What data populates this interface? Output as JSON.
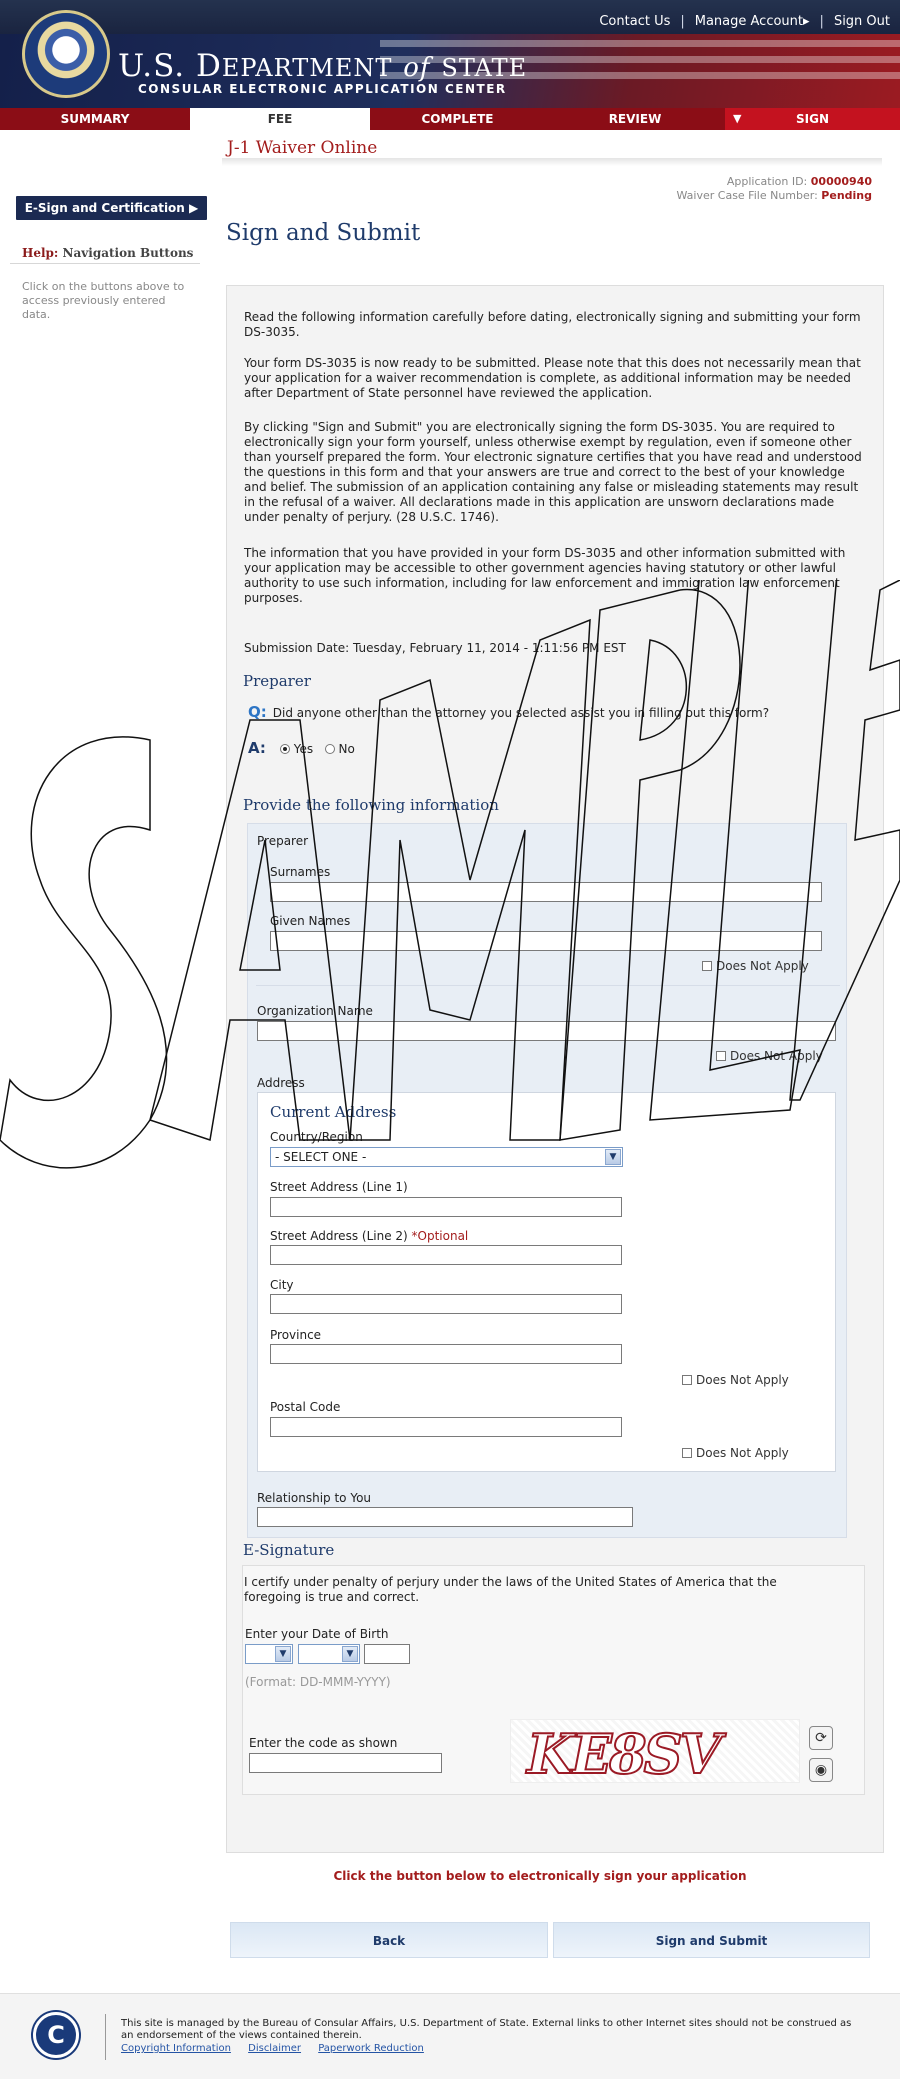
{
  "top_links": {
    "contact": "Contact Us",
    "manage": "Manage Account",
    "signout": "Sign Out"
  },
  "banner": {
    "dept_prefix": "U.S. D",
    "dept_rest": "EPARTMENT",
    "of": "of",
    "state": "STATE",
    "subtitle": "CONSULAR ELECTRONIC APPLICATION CENTER"
  },
  "tabs": {
    "summary": "SUMMARY",
    "fee": "FEE",
    "complete": "COMPLETE",
    "review": "REVIEW",
    "sign": "SIGN"
  },
  "sidebar": {
    "button": "E-Sign and Certification",
    "help_label": "Help:",
    "help_topic": "Navigation Buttons",
    "help_text": "Click on the buttons above to access previously entered data."
  },
  "header": {
    "app_title": "J-1 Waiver Online",
    "app_id_label": "Application ID:",
    "app_id": "00000940",
    "case_label": "Waiver Case File Number:",
    "case_value": "Pending"
  },
  "page_title": "Sign and Submit",
  "intro": {
    "p1": "Read the following information carefully before dating, electronically signing and submitting your form DS-3035.",
    "p2": "Your form DS-3035 is now ready to be submitted. Please note that this does not necessarily mean that your application for a waiver recommendation is complete, as additional information may be needed after Department of State personnel have reviewed the application.",
    "p3": "By clicking \"Sign and Submit\" you are electronically signing the form DS-3035. You are required to electronically sign your form yourself, unless otherwise exempt by regulation, even if someone other than yourself prepared the form. Your electronic signature certifies that you have read and understood the questions in this form and that your answers are true and correct to the best of your knowledge and belief. The submission of an application containing any false or misleading statements may result in the refusal of a waiver. All declarations made in this application are unsworn declarations made under penalty of perjury. (28 U.S.C. 1746).",
    "p4": "The information that you have provided in your form DS-3035 and other information submitted with your application may be accessible to other government agencies having statutory or other lawful authority to use such information, including for law enforcement and immigration law enforcement purposes.",
    "submission": "Submission Date: Tuesday, February 11, 2014 - 1:11:56 PM EST"
  },
  "preparer": {
    "heading": "Preparer",
    "q_mark": "Q:",
    "question": "Did anyone other than the attorney you selected assist you in filling out this form?",
    "a_mark": "A:",
    "yes": "Yes",
    "no": "No"
  },
  "info": {
    "heading": "Provide the following information",
    "box_label": "Preparer",
    "surnames": "Surnames",
    "given": "Given Names",
    "dna": "Does Not Apply",
    "org": "Organization Name",
    "address": "Address",
    "current_address": "Current Address",
    "country": "Country/Region",
    "country_value": "- SELECT ONE -",
    "street1": "Street Address (Line 1)",
    "street2": "Street Address (Line 2)",
    "optional": "*Optional",
    "city": "City",
    "province": "Province",
    "postal": "Postal Code",
    "relationship": "Relationship to You"
  },
  "esig": {
    "heading": "E-Signature",
    "certify": "I certify under penalty of perjury under the laws of the United States of America that the foregoing is true and correct.",
    "dob": "Enter your Date of Birth",
    "format": "(Format: DD-MMM-YYYY)",
    "code": "Enter the code as shown",
    "captcha": "KE8SV"
  },
  "notice": "Click the button below to electronically sign your application",
  "buttons": {
    "back": "Back",
    "submit": "Sign and Submit"
  },
  "footer": {
    "text": "This site is managed by the Bureau of Consular Affairs, U.S. Department of State. External links to other Internet sites should not be construed as an endorsement of the views contained therein.",
    "links": [
      "Copyright Information",
      "Disclaimer",
      "Paperwork Reduction"
    ]
  },
  "watermark": "SAMPLE"
}
